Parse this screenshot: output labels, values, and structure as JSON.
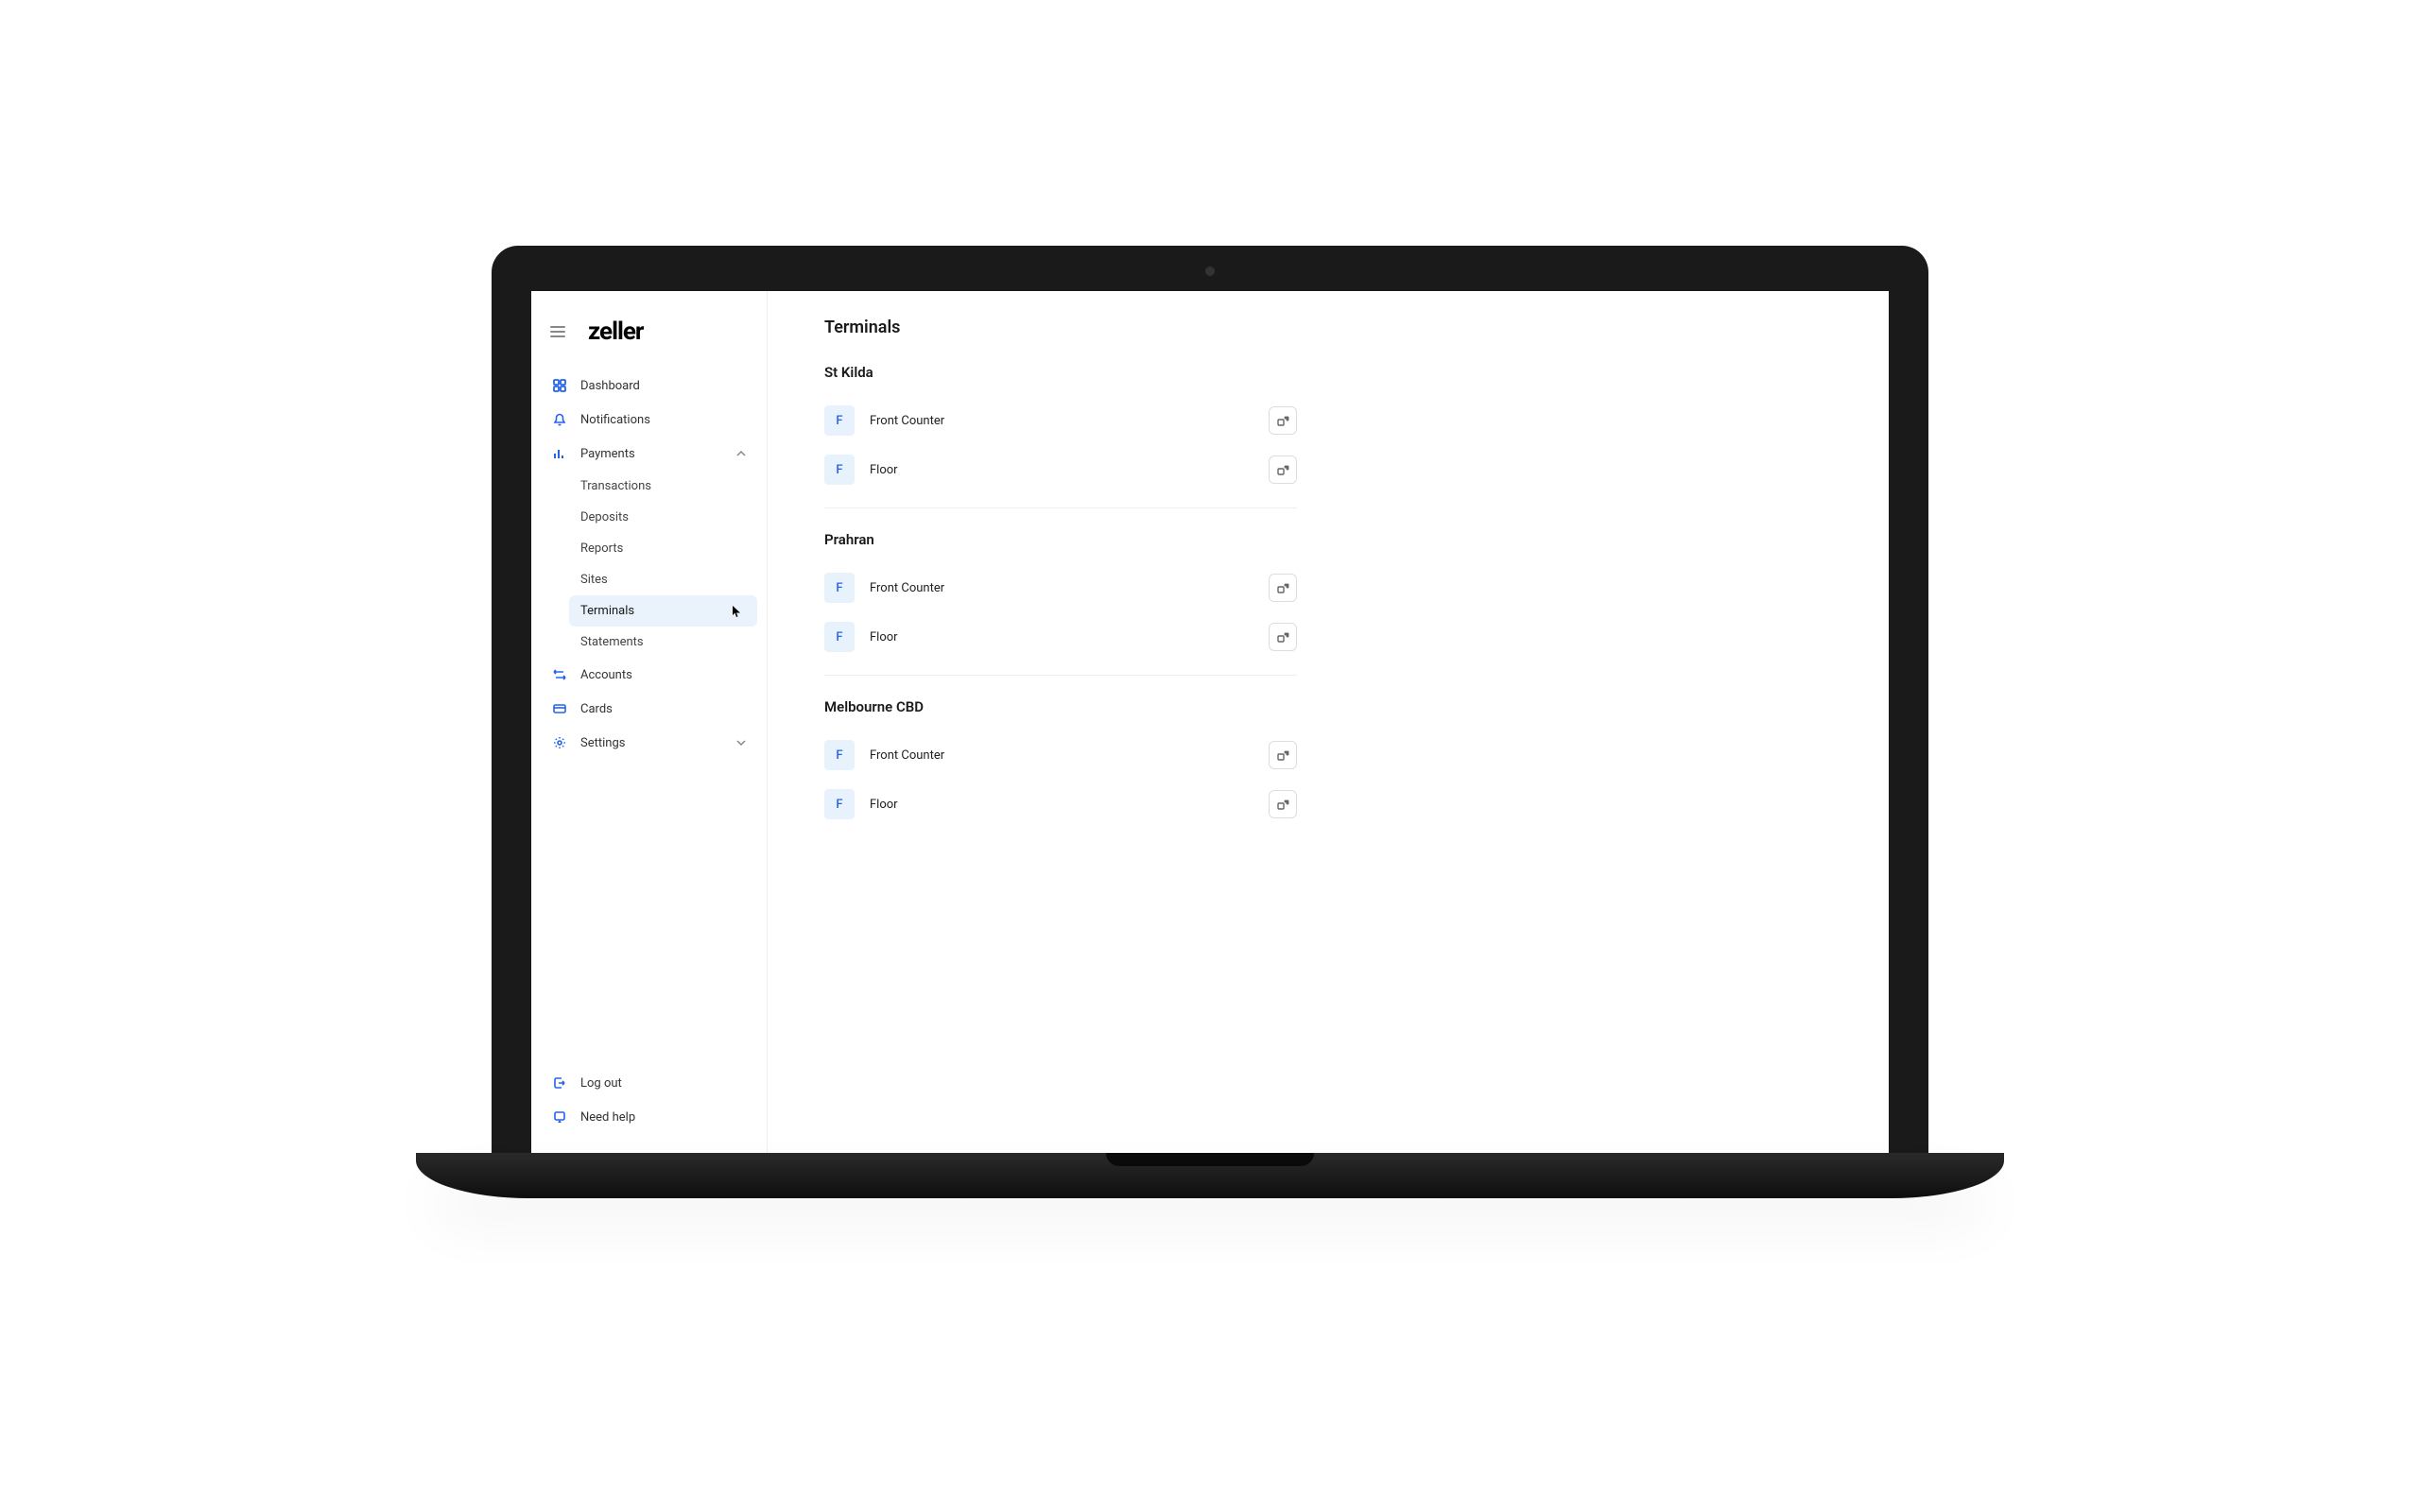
{
  "logo": "zeller",
  "sidebar": {
    "items": [
      {
        "label": "Dashboard"
      },
      {
        "label": "Notifications"
      },
      {
        "label": "Payments"
      },
      {
        "label": "Accounts"
      },
      {
        "label": "Cards"
      },
      {
        "label": "Settings"
      }
    ],
    "payments_sub": [
      {
        "label": "Transactions"
      },
      {
        "label": "Deposits"
      },
      {
        "label": "Reports"
      },
      {
        "label": "Sites"
      },
      {
        "label": "Terminals"
      },
      {
        "label": "Statements"
      }
    ],
    "footer": [
      {
        "label": "Log out"
      },
      {
        "label": "Need help"
      }
    ]
  },
  "main": {
    "title": "Terminals",
    "sections": [
      {
        "name": "St Kilda",
        "terminals": [
          {
            "badge": "F",
            "name": "Front Counter"
          },
          {
            "badge": "F",
            "name": "Floor"
          }
        ]
      },
      {
        "name": "Prahran",
        "terminals": [
          {
            "badge": "F",
            "name": "Front Counter"
          },
          {
            "badge": "F",
            "name": "Floor"
          }
        ]
      },
      {
        "name": "Melbourne CBD",
        "terminals": [
          {
            "badge": "F",
            "name": "Front Counter"
          },
          {
            "badge": "F",
            "name": "Floor"
          }
        ]
      }
    ]
  }
}
